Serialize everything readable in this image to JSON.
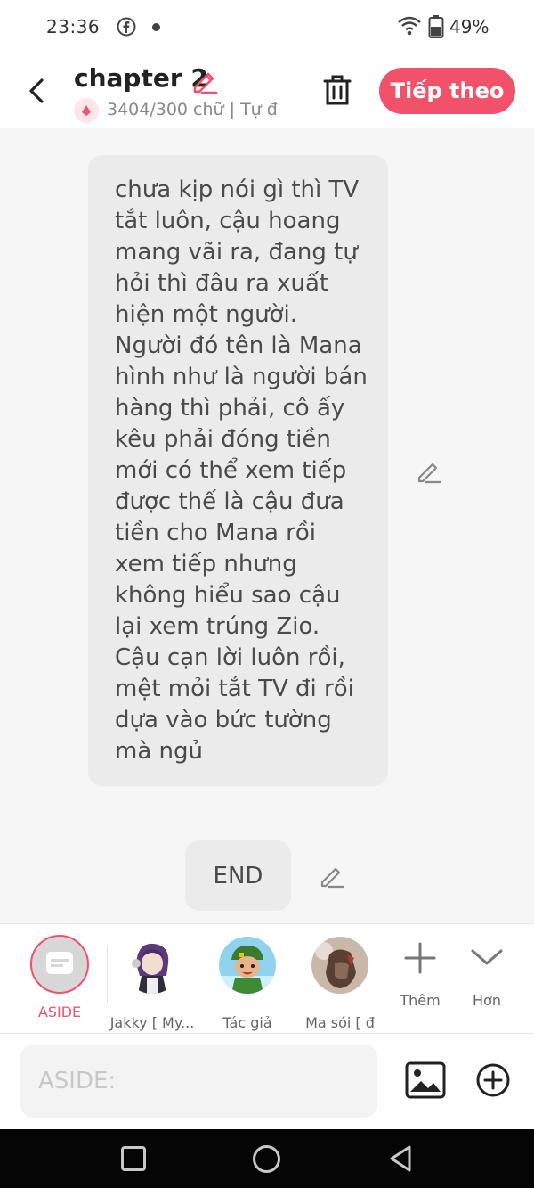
{
  "status_bar": {
    "time": "23:36",
    "battery_percent": "49%",
    "icons": [
      "facebook-icon",
      "dot-icon",
      "wifi-icon",
      "battery-icon"
    ]
  },
  "header": {
    "title": "chapter 2",
    "subtitle": "3404/300 chữ | Tự đ",
    "next_label": "Tiếp theo",
    "icons": [
      "back-icon",
      "pencil-icon",
      "trash-icon"
    ]
  },
  "content": {
    "message": "chưa kịp nói gì thì TV tắt luôn, cậu hoang mang vãi ra, đang tự hỏi thì đâu ra xuất hiện một người. Người đó tên là Mana hình như là người bán hàng thì phải, cô ấy kêu phải đóng tiền mới có thể xem tiếp được thế là cậu đưa tiền cho Mana rồi xem tiếp nhưng không hiểu sao cậu lại xem trúng Zio. Cậu cạn lời luôn rồi, mệt mỏi tắt TV đi rồi dựa vào bức tường mà ngủ",
    "end_label": "END"
  },
  "characters": {
    "aside_label": "ASIDE",
    "items": [
      {
        "name": "Jakky [ My..."
      },
      {
        "name": "Tác giả"
      },
      {
        "name": "Ma sói [ đ"
      }
    ],
    "more_label": "Thêm",
    "expand_label": "Hơn"
  },
  "input": {
    "placeholder": "ASIDE:"
  },
  "colors": {
    "accent": "#f2516a",
    "bubble": "#ebebeb",
    "background": "#f6f6f6"
  }
}
